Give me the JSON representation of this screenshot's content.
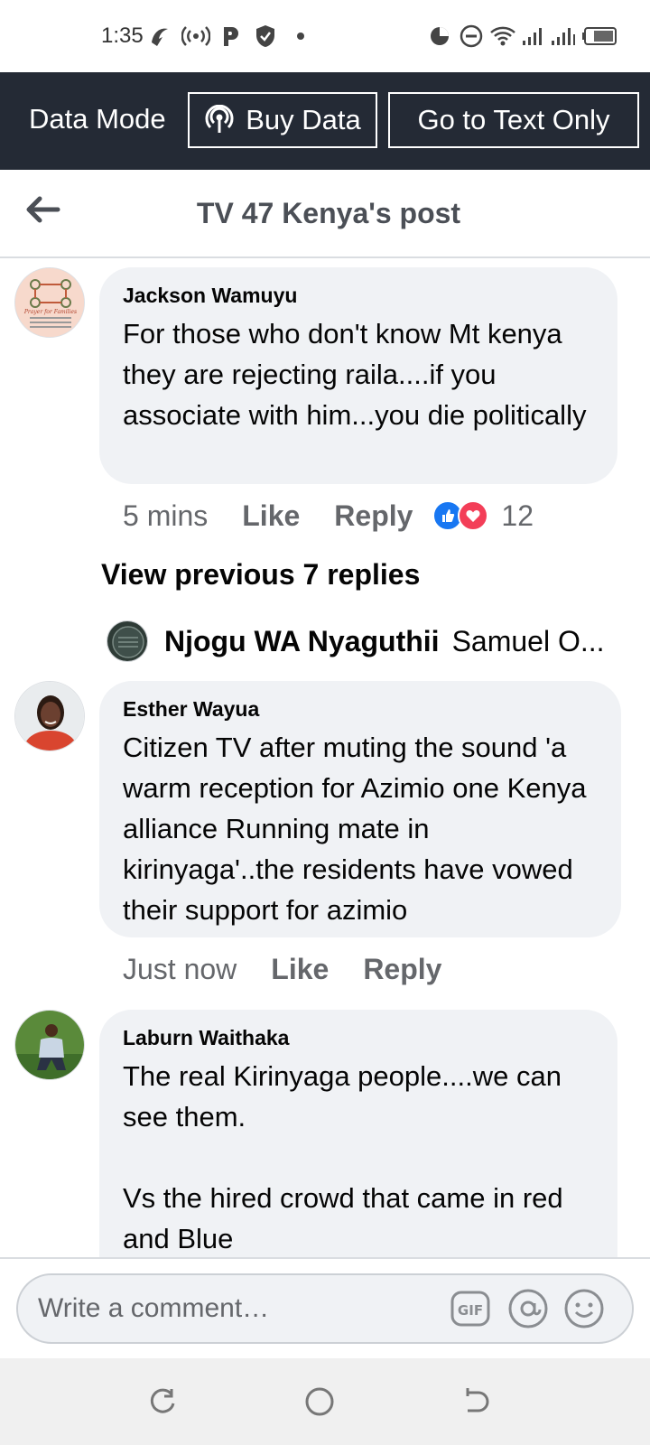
{
  "status_bar": {
    "time": "1:35",
    "icons": [
      "location-icon",
      "hotspot-icon",
      "parking-app-icon",
      "shield-icon",
      "dot-icon",
      "data-saver-icon",
      "do-not-disturb-icon",
      "wifi-icon",
      "signal-icon",
      "signal-icon-2",
      "battery-icon"
    ]
  },
  "data_bar": {
    "mode_label": "Data Mode",
    "buy_label": "Buy Data",
    "text_only_label": "Go to Text Only"
  },
  "header": {
    "title": "TV 47 Kenya's post"
  },
  "comments": [
    {
      "author": "Jackson Wamuyu",
      "text": "For those who don't know Mt kenya they are rejecting raila....if you associate with him...you die politically",
      "time": "5 mins",
      "like": "Like",
      "reply": "Reply",
      "reaction_count": "12",
      "avatar_text": "Prayer for Families"
    },
    {
      "author": "Esther Wayua",
      "text": "Citizen TV after muting the sound 'a warm reception for Azimio one Kenya alliance  Running mate in kirinyaga'..the residents have vowed their support for azimio",
      "time": "Just now",
      "like": "Like",
      "reply": "Reply"
    },
    {
      "author": "Laburn Waithaka",
      "text": "The real Kirinyaga people....we can see them.\n\nVs the hired crowd that came in red and Blue"
    }
  ],
  "replies": {
    "view_previous": "View previous 7 replies",
    "preview_name": "Njogu WA Nyaguthii",
    "preview_text": "Samuel O..."
  },
  "composer": {
    "placeholder": "Write a comment…"
  },
  "colors": {
    "data_bar_bg": "#242a35",
    "bubble_bg": "#f0f2f5",
    "like_blue": "#1877f2",
    "love_red": "#f33e58"
  }
}
